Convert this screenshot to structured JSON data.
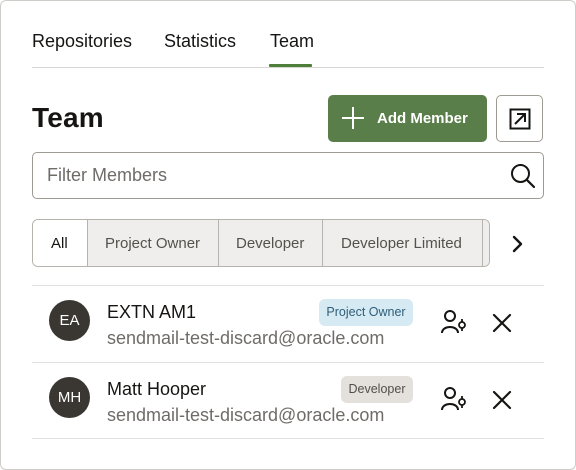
{
  "tabs": [
    {
      "label": "Repositories"
    },
    {
      "label": "Statistics"
    },
    {
      "label": "Team",
      "selected": true
    }
  ],
  "heading": "Team",
  "add_member": {
    "label": "Add Member"
  },
  "search": {
    "placeholder": "Filter Members",
    "value": ""
  },
  "filters": [
    {
      "label": "All",
      "selected": true
    },
    {
      "label": "Project Owner"
    },
    {
      "label": "Developer"
    },
    {
      "label": "Developer Limited"
    },
    {
      "label": ""
    }
  ],
  "members": [
    {
      "initials": "EA",
      "name": "EXTN AM1",
      "email": "sendmail-test-discard@oracle.com",
      "role": "Project Owner"
    },
    {
      "initials": "MH",
      "name": "Matt Hooper",
      "email": "sendmail-test-discard@oracle.com",
      "role": "Developer"
    }
  ],
  "colors": {
    "accent": "#5a7e49",
    "tab_indicator": "#4f7d3a",
    "owner_badge_bg": "#d6eaf3",
    "developer_badge_bg": "#e4e1dd",
    "avatar_bg": "#3a3632"
  },
  "icons": {
    "add": "plus-icon",
    "expand": "open-external-icon",
    "search": "search-icon",
    "next": "chevron-right-icon",
    "change_role": "user-settings-icon",
    "remove": "close-icon"
  }
}
